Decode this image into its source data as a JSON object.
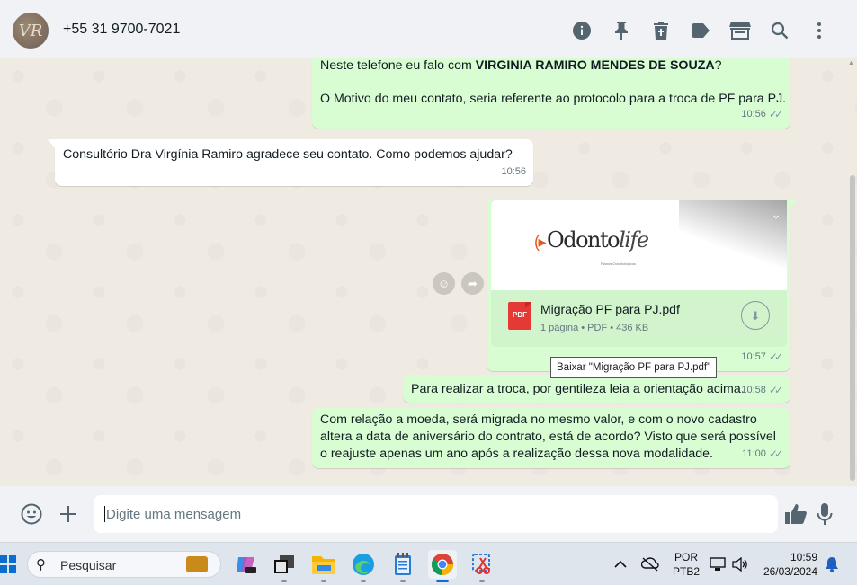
{
  "header": {
    "avatar_text": "VR",
    "contact": "+55 31 9700-7021",
    "icons": [
      "info-icon",
      "pin-icon",
      "trash-icon",
      "label-icon",
      "store-icon",
      "search-icon",
      "more-vertical-icon"
    ]
  },
  "messages": [
    {
      "id": "m1",
      "direction": "out",
      "line1_prefix": "Neste telefone eu falo com ",
      "line1_bold": "VIRGINIA RAMIRO MENDES DE SOUZA",
      "line1_suffix": "?",
      "line2": "O Motivo do meu contato, seria referente ao protocolo para a troca de PF para PJ.",
      "time": "10:56"
    },
    {
      "id": "m2",
      "direction": "in",
      "text": "Consultório Dra Virgínia Ramiro agradece seu contato. Como podemos ajudar?",
      "time": "10:56"
    },
    {
      "id": "m3",
      "direction": "out",
      "type": "document",
      "preview_logo_main": "Odonto",
      "preview_logo_accent": "life",
      "preview_logo_sub": "Planos Odontológicos",
      "file_badge": "PDF",
      "file_name": "Migração PF para PJ.pdf",
      "file_info": "1 página • PDF • 436 KB",
      "time": "10:57"
    },
    {
      "id": "m4",
      "direction": "out",
      "text": "Para realizar a troca, por gentileza leia a orientação acima.",
      "time": "10:58"
    },
    {
      "id": "m5",
      "direction": "out",
      "text": "Com relação a moeda, será migrada no mesmo valor, e com o novo cadastro altera a data de aniversário do contrato, está de acordo? Visto que será possível o reajuste apenas um ano após a realização dessa nova modalidade.",
      "time": "11:00"
    }
  ],
  "tooltip": "Baixar \"Migração PF para PJ.pdf\"",
  "composer": {
    "placeholder": "Digite uma mensagem",
    "value": ""
  },
  "taskbar": {
    "search_label": "Pesquisar",
    "language_line1": "POR",
    "language_line2": "PTB2",
    "time": "10:59",
    "date": "26/03/2024"
  },
  "colors": {
    "outgoing_bubble": "#d9fdd3",
    "incoming_bubble": "#ffffff",
    "chat_background": "#efeae2",
    "pdf_red": "#e53935"
  }
}
